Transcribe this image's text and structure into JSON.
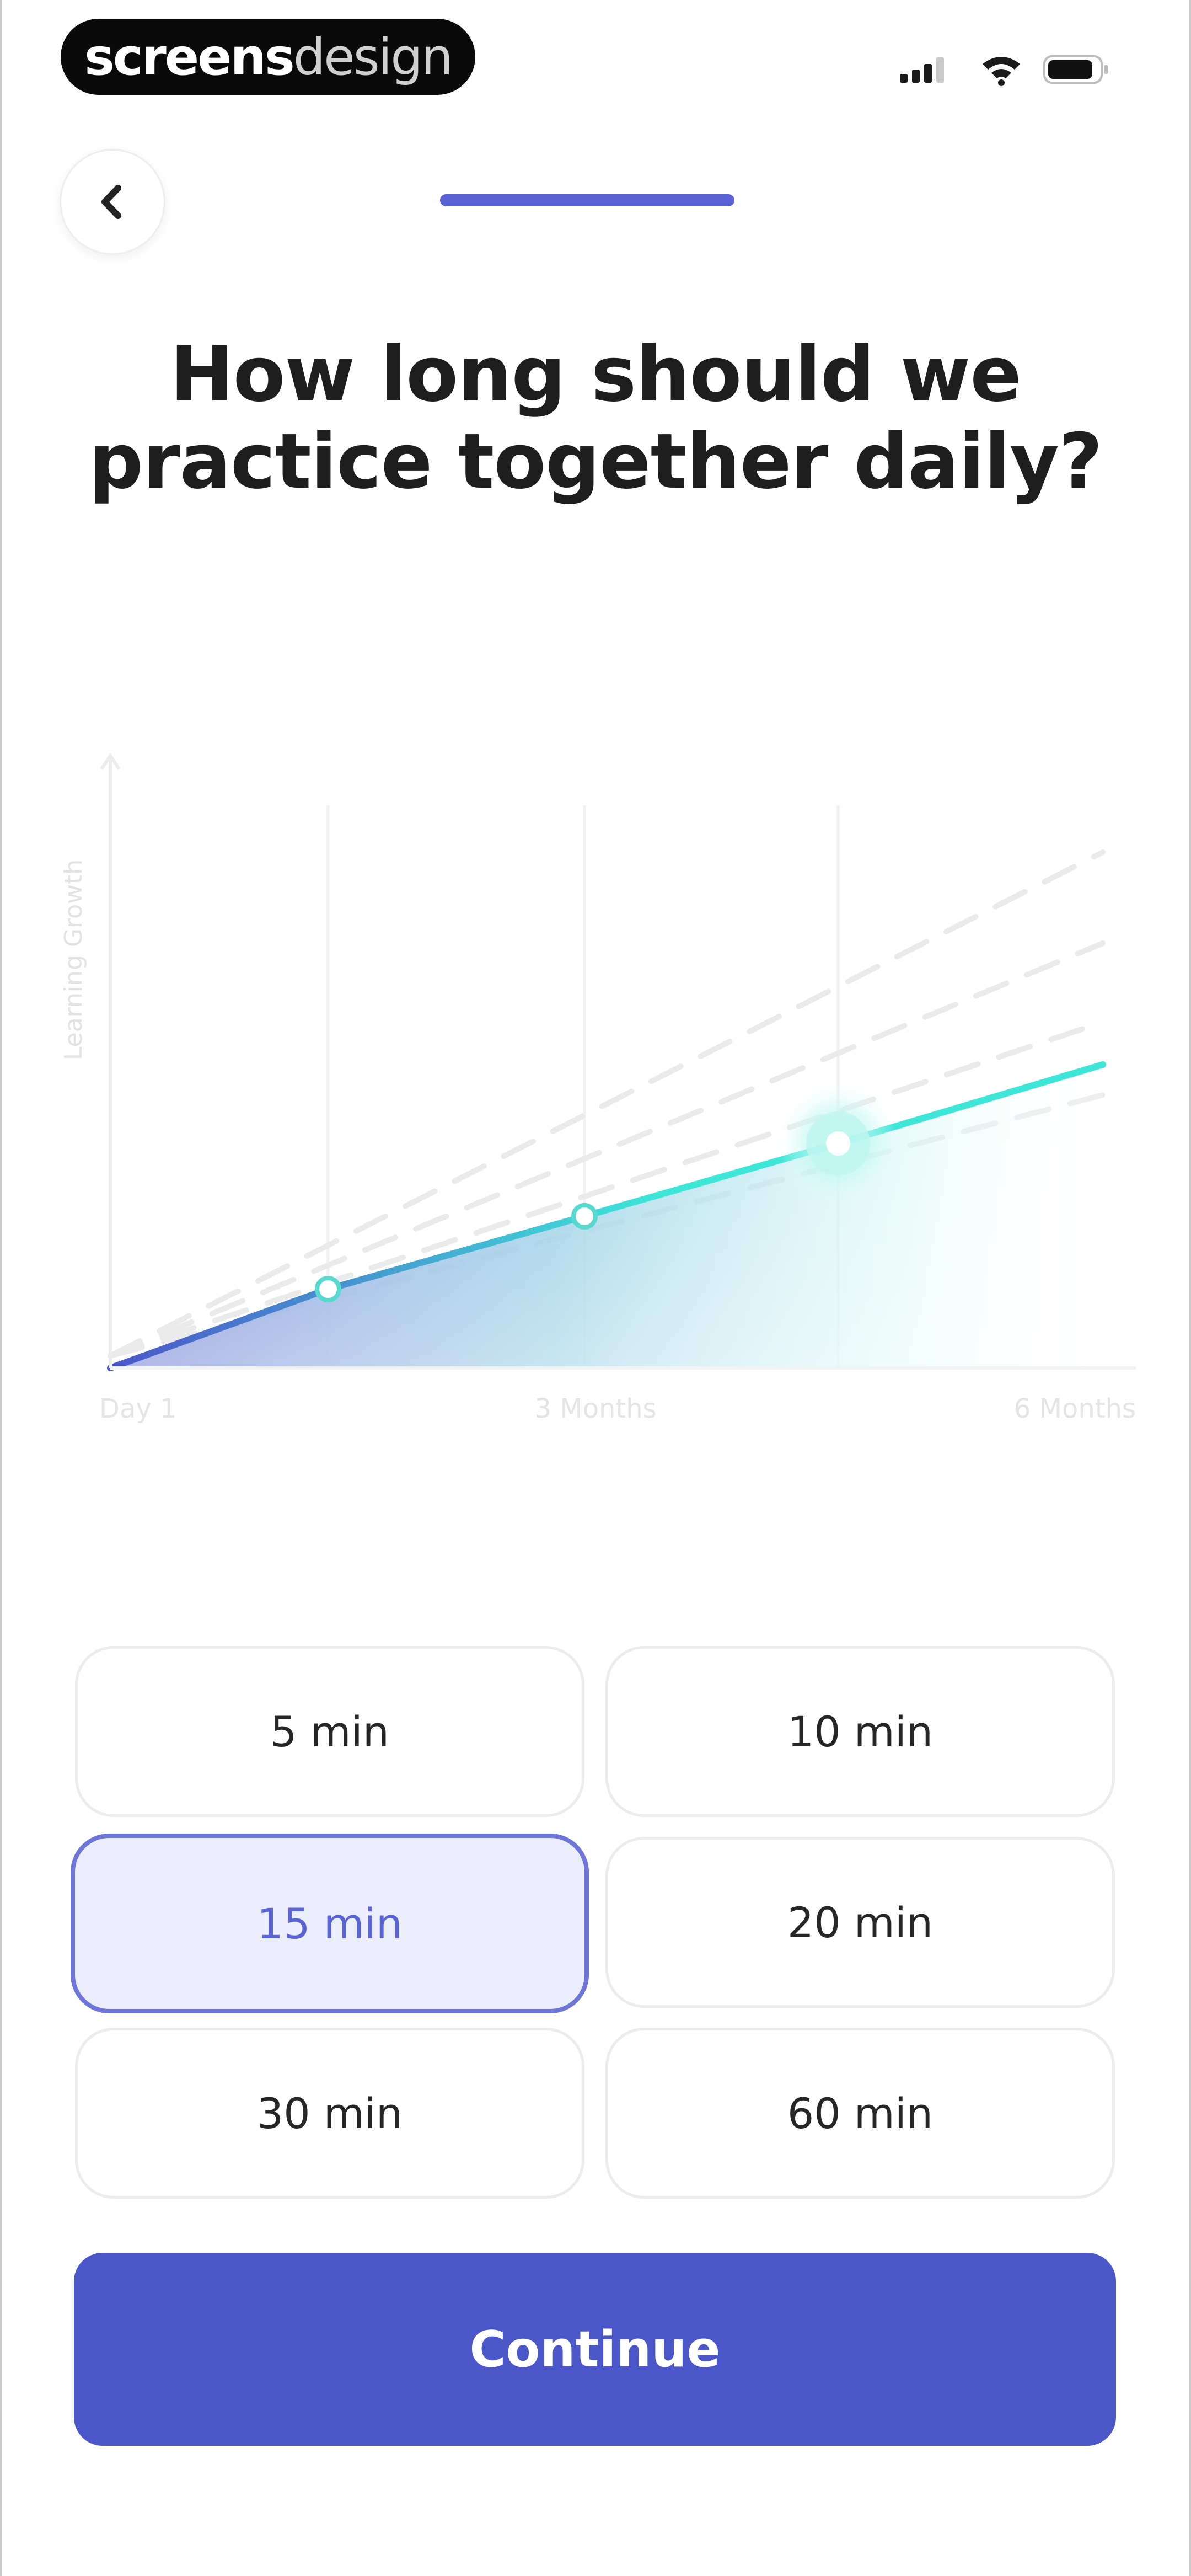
{
  "status_bar": {
    "brand_prefix": "screens",
    "brand_suffix": "design",
    "signal_icon": "cellular-signal-icon",
    "wifi_icon": "wifi-icon",
    "battery_icon": "battery-icon"
  },
  "nav": {
    "back_icon": "chevron-left-icon",
    "progress": 1.0
  },
  "question": "How long should we practice together daily?",
  "chart_data": {
    "type": "line",
    "ylabel": "Learning Growth",
    "x_tick_labels": [
      "Day 1",
      "3 Months",
      "6 Months"
    ],
    "grid": true,
    "series": [
      {
        "values": [
          0,
          0.13,
          0.25,
          0.37
        ]
      }
    ],
    "reference_lines": 4,
    "colors": {
      "start": "#4b56c9",
      "end": "#3ee6d8"
    }
  },
  "options": [
    {
      "label": "5 min",
      "selected": false
    },
    {
      "label": "10 min",
      "selected": false
    },
    {
      "label": "15 min",
      "selected": true
    },
    {
      "label": "20 min",
      "selected": false
    },
    {
      "label": "30 min",
      "selected": false
    },
    {
      "label": "60 min",
      "selected": false
    }
  ],
  "continue_label": "Continue",
  "colors": {
    "accent": "#4b56c9",
    "selected_bg": "#ecedfb",
    "teal": "#3ee6d8"
  }
}
